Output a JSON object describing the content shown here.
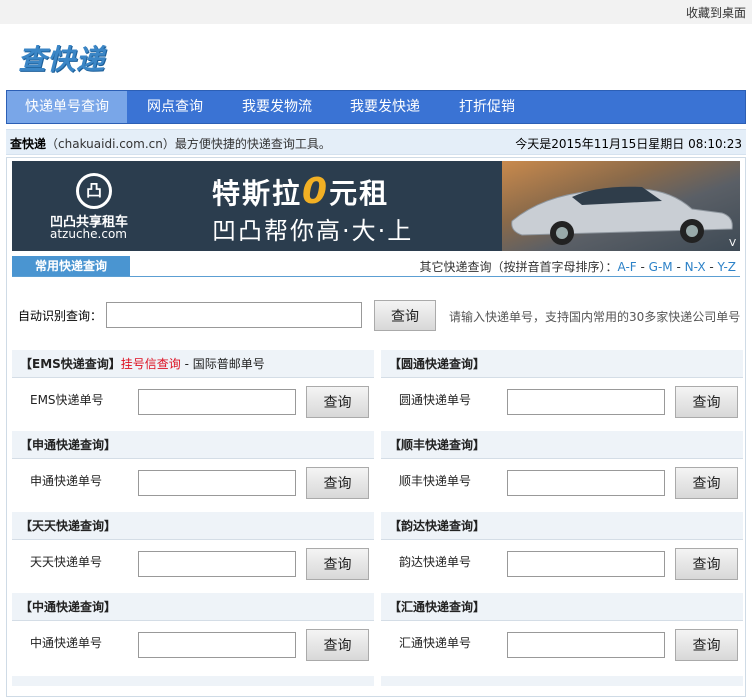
{
  "topbar": {
    "favorite_label": "收藏到桌面"
  },
  "header": {
    "logo_text": "查快递"
  },
  "nav": {
    "items": [
      {
        "label": "快递单号查询",
        "active": true
      },
      {
        "label": "网点查询"
      },
      {
        "label": "我要发物流"
      },
      {
        "label": "我要发快递"
      },
      {
        "label": "打折促销"
      }
    ]
  },
  "info": {
    "brand": "查快递",
    "desc": "（chakuaidi.com.cn）最方便快捷的快递查询工具。",
    "date": "今天是2015年11月15日星期日  08:10:23"
  },
  "banner": {
    "brand_name": "凹凸共享租车",
    "brand_url": "atzuche.com",
    "brand_glyph": "凸",
    "headline_pre": "特斯拉",
    "headline_zero": "0",
    "headline_post": "元租",
    "subline": "凹凸帮你高·大·上",
    "corner": "V"
  },
  "tabs": {
    "common": "常用快递查询",
    "other_prefix": "其它快递查询（按拼音首字母排序）：",
    "ranges": [
      "A-F",
      "G-M",
      "N-X",
      "Y-Z"
    ],
    "sep": " - "
  },
  "auto": {
    "label": "自动识别查询：",
    "value": "",
    "button": "查询",
    "hint": "请输入快递单号，支持国内常用的30多家快递公司单号"
  },
  "panels": [
    {
      "title": "【EMS快递查询】",
      "extra_red": "挂号信查询",
      "extra_plain": " - 国际普邮单号",
      "label": "EMS快递单号",
      "button": "查询"
    },
    {
      "title": "【圆通快递查询】",
      "label": "圆通快递单号",
      "button": "查询"
    },
    {
      "title": "【申通快递查询】",
      "label": "申通快递单号",
      "button": "查询"
    },
    {
      "title": "【顺丰快递查询】",
      "label": "顺丰快递单号",
      "button": "查询"
    },
    {
      "title": "【天天快递查询】",
      "label": "天天快递单号",
      "button": "查询"
    },
    {
      "title": "【韵达快递查询】",
      "label": "韵达快递单号",
      "button": "查询"
    },
    {
      "title": "【中通快递查询】",
      "label": "中通快递单号",
      "button": "查询"
    },
    {
      "title": "【汇通快递查询】",
      "label": "汇通快递单号",
      "button": "查询"
    }
  ],
  "colors": {
    "nav_bg": "#3a73d4",
    "nav_active": "#79a6e8",
    "tab_bg": "#4a95d1",
    "link": "#2d82c8",
    "red": "#dd1122"
  }
}
